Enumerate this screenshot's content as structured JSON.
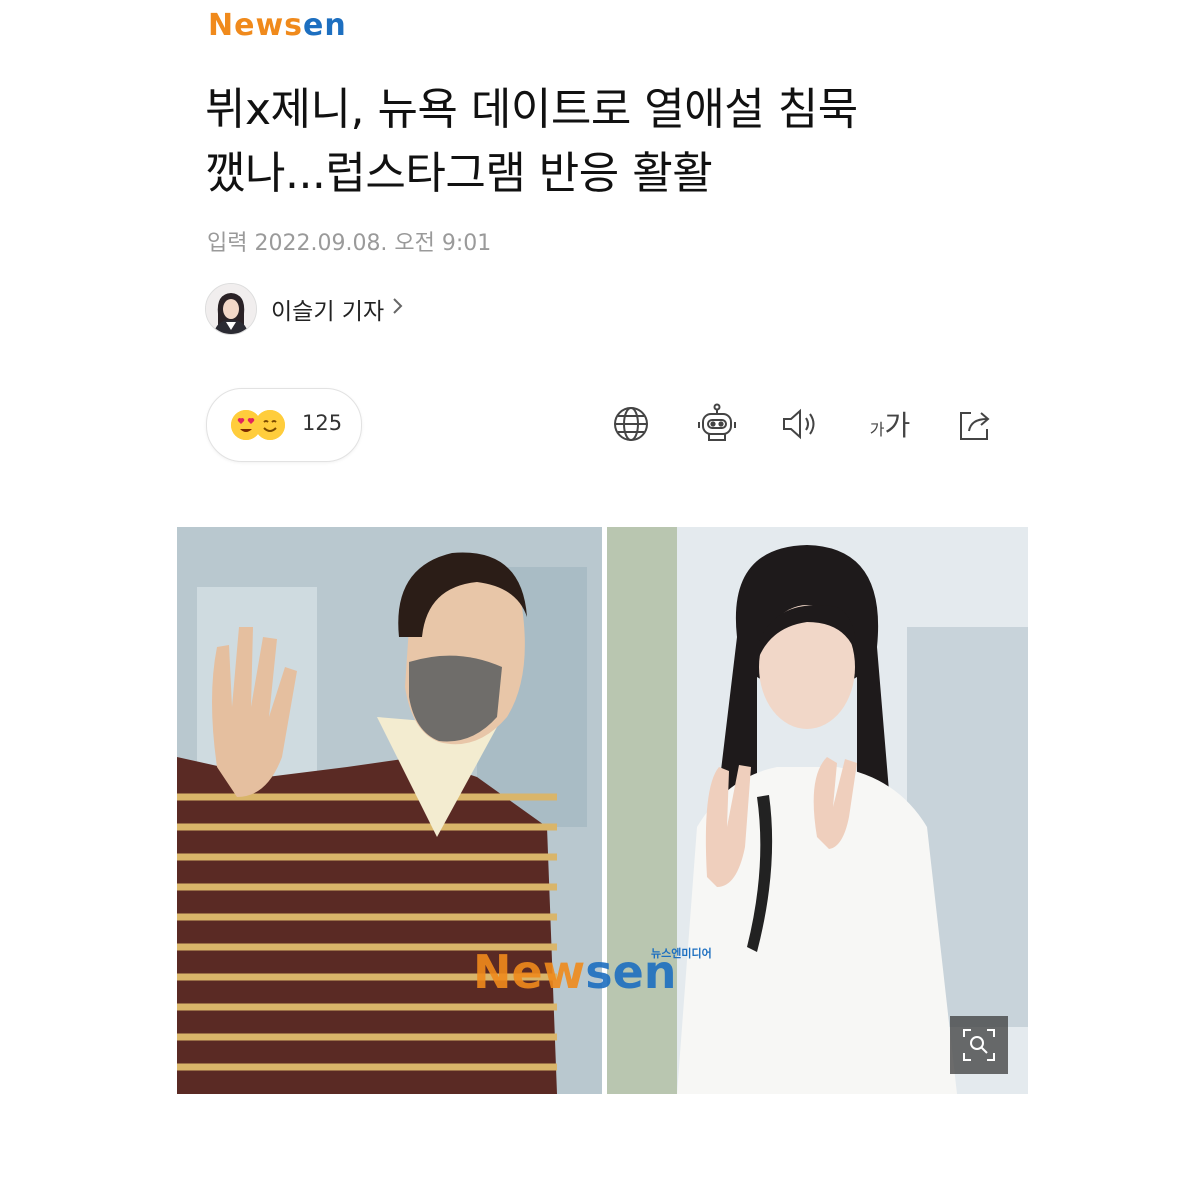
{
  "header": {
    "logo_n": "N",
    "logo_ews": "ews",
    "logo_en": "en"
  },
  "article": {
    "headline_line1": "뷔x제니, 뉴욕 데이트로 열애설 침묵",
    "headline_line2": "깼나...럽스타그램 반응 활활",
    "date": "입력 2022.09.08. 오전 9:01",
    "author": "이슬기 기자"
  },
  "reactions": {
    "count": "125"
  },
  "toolbar": {
    "font_small": "가",
    "font_large": "가"
  },
  "photo": {
    "watermark_orange": "New",
    "watermark_blue": "sen",
    "watermark_sub": "뉴스엔미디어"
  },
  "colors": {
    "brand_orange": "#f08a1c",
    "brand_blue": "#1d6fc0",
    "emoji_yellow": "#ffcd3c"
  },
  "icons": [
    "globe-icon",
    "robot-icon",
    "speaker-icon",
    "font-size-icon",
    "share-icon",
    "zoom-icon",
    "chevron-right-icon"
  ]
}
